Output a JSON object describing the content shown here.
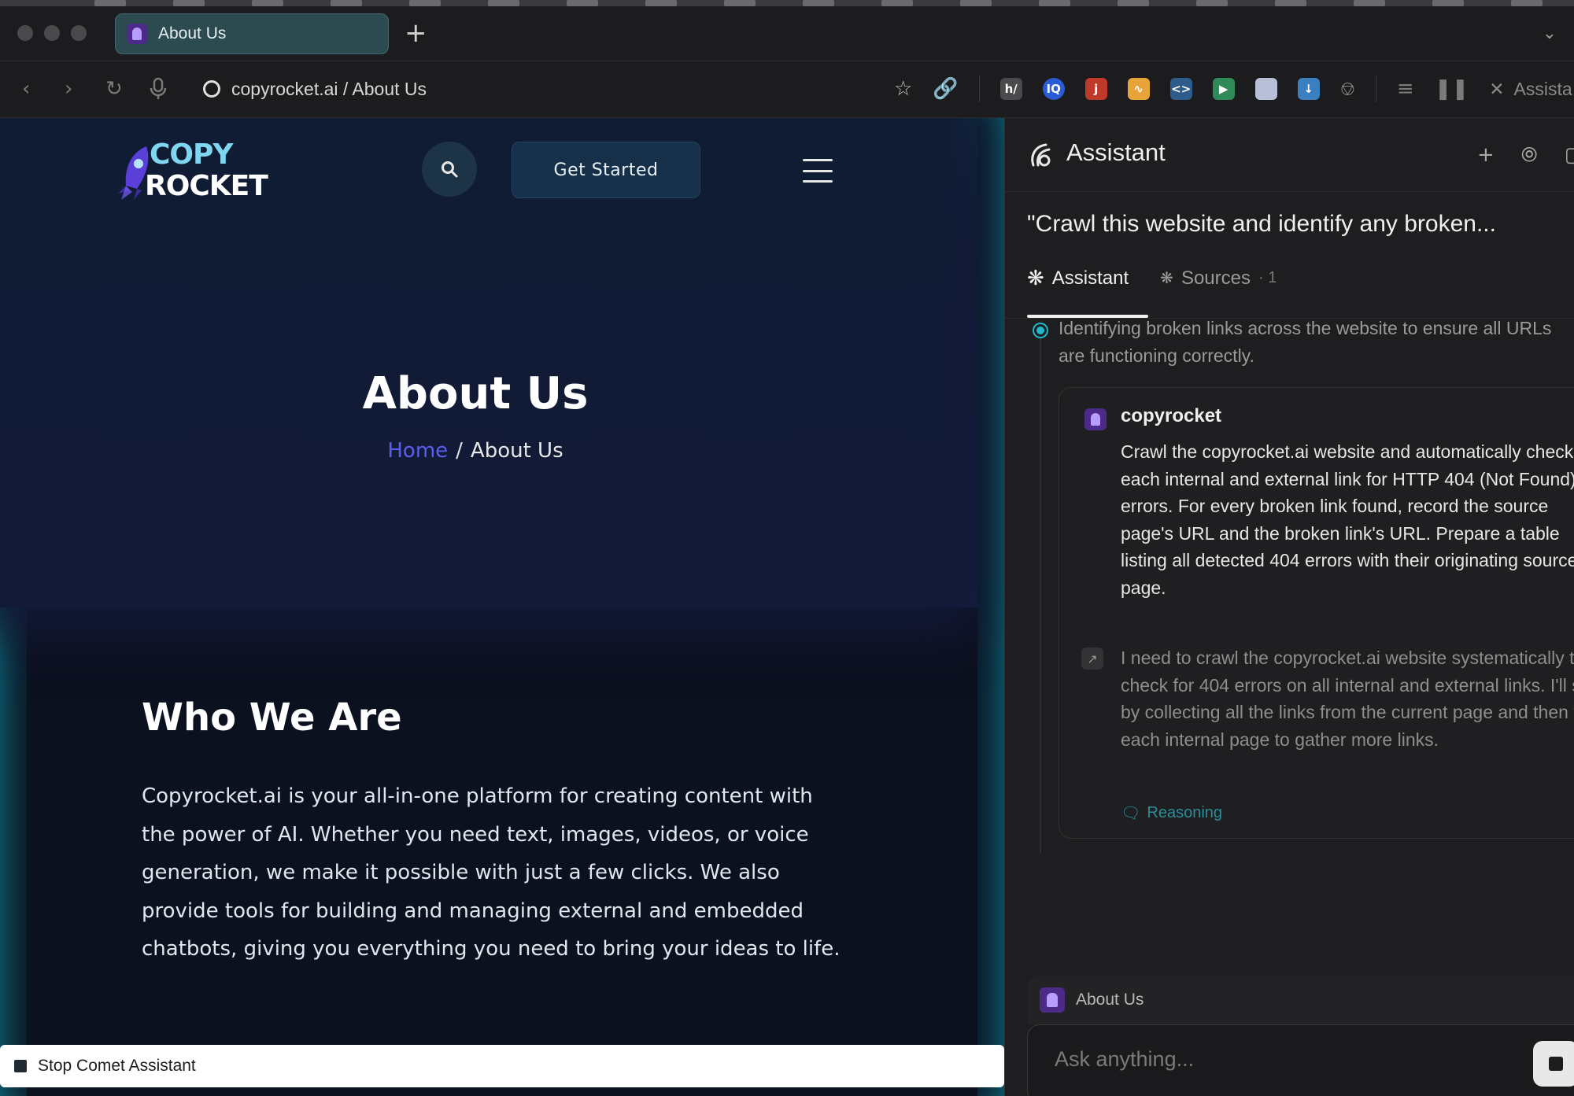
{
  "browser": {
    "tab_title": "About Us",
    "new_tab_label": "+",
    "url": "copyrocket.ai / About Us",
    "assistant_tab_label": "Assista"
  },
  "site": {
    "logo_line1": "COPY",
    "logo_line2": "ROCKET",
    "cta_label": "Get Started",
    "hero_title": "About Us",
    "breadcrumb": {
      "home": "Home",
      "separator": "/",
      "current": "About Us"
    },
    "section_title": "Who We Are",
    "section_text": "Copyrocket.ai is your all-in-one platform for creating content with the power of AI. Whether you need text, images, videos, or voice generation, we make it possible with just a few clicks. We also provide tools for building and managing external and embedded chatbots, giving you everything you need to bring your ideas to life.",
    "stop_label": "Stop Comet Assistant"
  },
  "assistant": {
    "title": "Assistant",
    "query": "\"Crawl this website and identify any broken...",
    "tabs": [
      {
        "label": "Assistant"
      },
      {
        "label": "Sources",
        "count": "· 1"
      }
    ],
    "step_text": "Identifying broken links across the website to ensure all URLs are functioning correctly.",
    "card": {
      "name": "copyrocket",
      "task": "Crawl the copyrocket.ai website and automatically check each internal and external link for HTTP 404 (Not Found) errors. For every broken link found, record the source page's URL and the broken link's URL. Prepare a table listing all detected 404 errors with their originating source page.",
      "reasoning_text": "I need to crawl the copyrocket.ai website systematically to check for 404 errors on all internal and external links. I'll start by collecting all the links from the current page and then visit each internal page to gather more links.",
      "reasoning_label": "Reasoning"
    },
    "context_label": "About Us",
    "ask_placeholder": "Ask anything..."
  },
  "colors": {
    "accent_teal": "#0fa3b5",
    "breadcrumb_link": "#5b5cf0",
    "status_dot": "#20b8c8"
  }
}
